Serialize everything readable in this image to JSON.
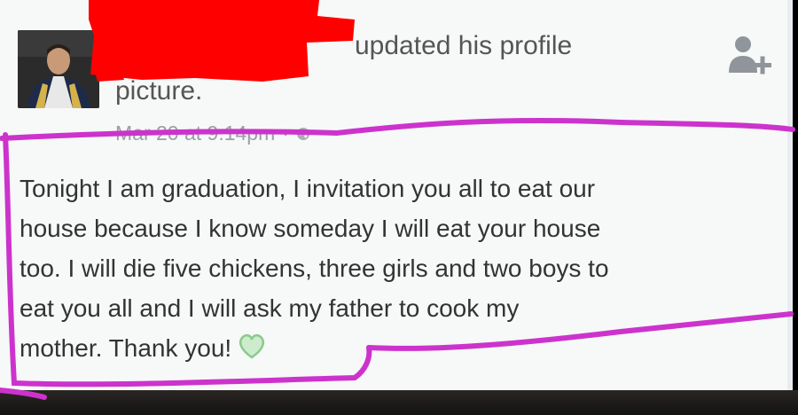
{
  "post": {
    "header_line1": "updated his profile",
    "header_line2": "picture.",
    "timestamp": "Mar 20 at 9:14pm",
    "separator": "·",
    "privacy_icon": "globe-icon",
    "body_lines": [
      "Tonight I am graduation, I invitation you all to eat our",
      "house because I know someday I will eat your house",
      "too. I will die five chickens, three girls and two boys to",
      "eat you all and I will ask my father to cook my",
      "mother. Thank you!"
    ],
    "emoji": "green-heart-icon"
  },
  "actions": {
    "add_friend_icon": "add-friend-icon"
  },
  "colors": {
    "redaction": "#ff0000",
    "annotation": "#cc33cc",
    "heart": "#9bd39b",
    "card_bg": "#f7f8f8"
  }
}
